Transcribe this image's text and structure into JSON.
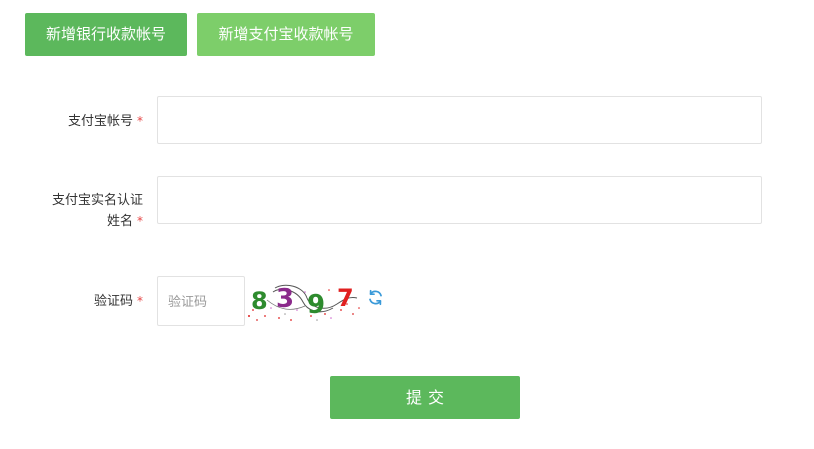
{
  "tabs": {
    "bank_label": "新增银行收款帐号",
    "alipay_label": "新增支付宝收款帐号"
  },
  "form": {
    "account_label": "支付宝帐号",
    "realname_label_line1": "支付宝实名认证",
    "realname_label_line2": "姓名",
    "captcha_label": "验证码",
    "required_mark": "*",
    "account_value": "",
    "realname_value": "",
    "captcha_placeholder": "验证码"
  },
  "captcha": {
    "chars": [
      "8",
      "3",
      "9",
      "7"
    ],
    "colors": [
      "#2e8b2e",
      "#8b2a8b",
      "#2e8b2e",
      "#e02020"
    ]
  },
  "icons": {
    "refresh": "refresh-icon"
  },
  "colors": {
    "primary_green": "#5cb85c",
    "light_green": "#7dce6a",
    "required_red": "#e64545",
    "refresh_blue": "#3a9ad9"
  },
  "submit": {
    "label": "提交"
  }
}
